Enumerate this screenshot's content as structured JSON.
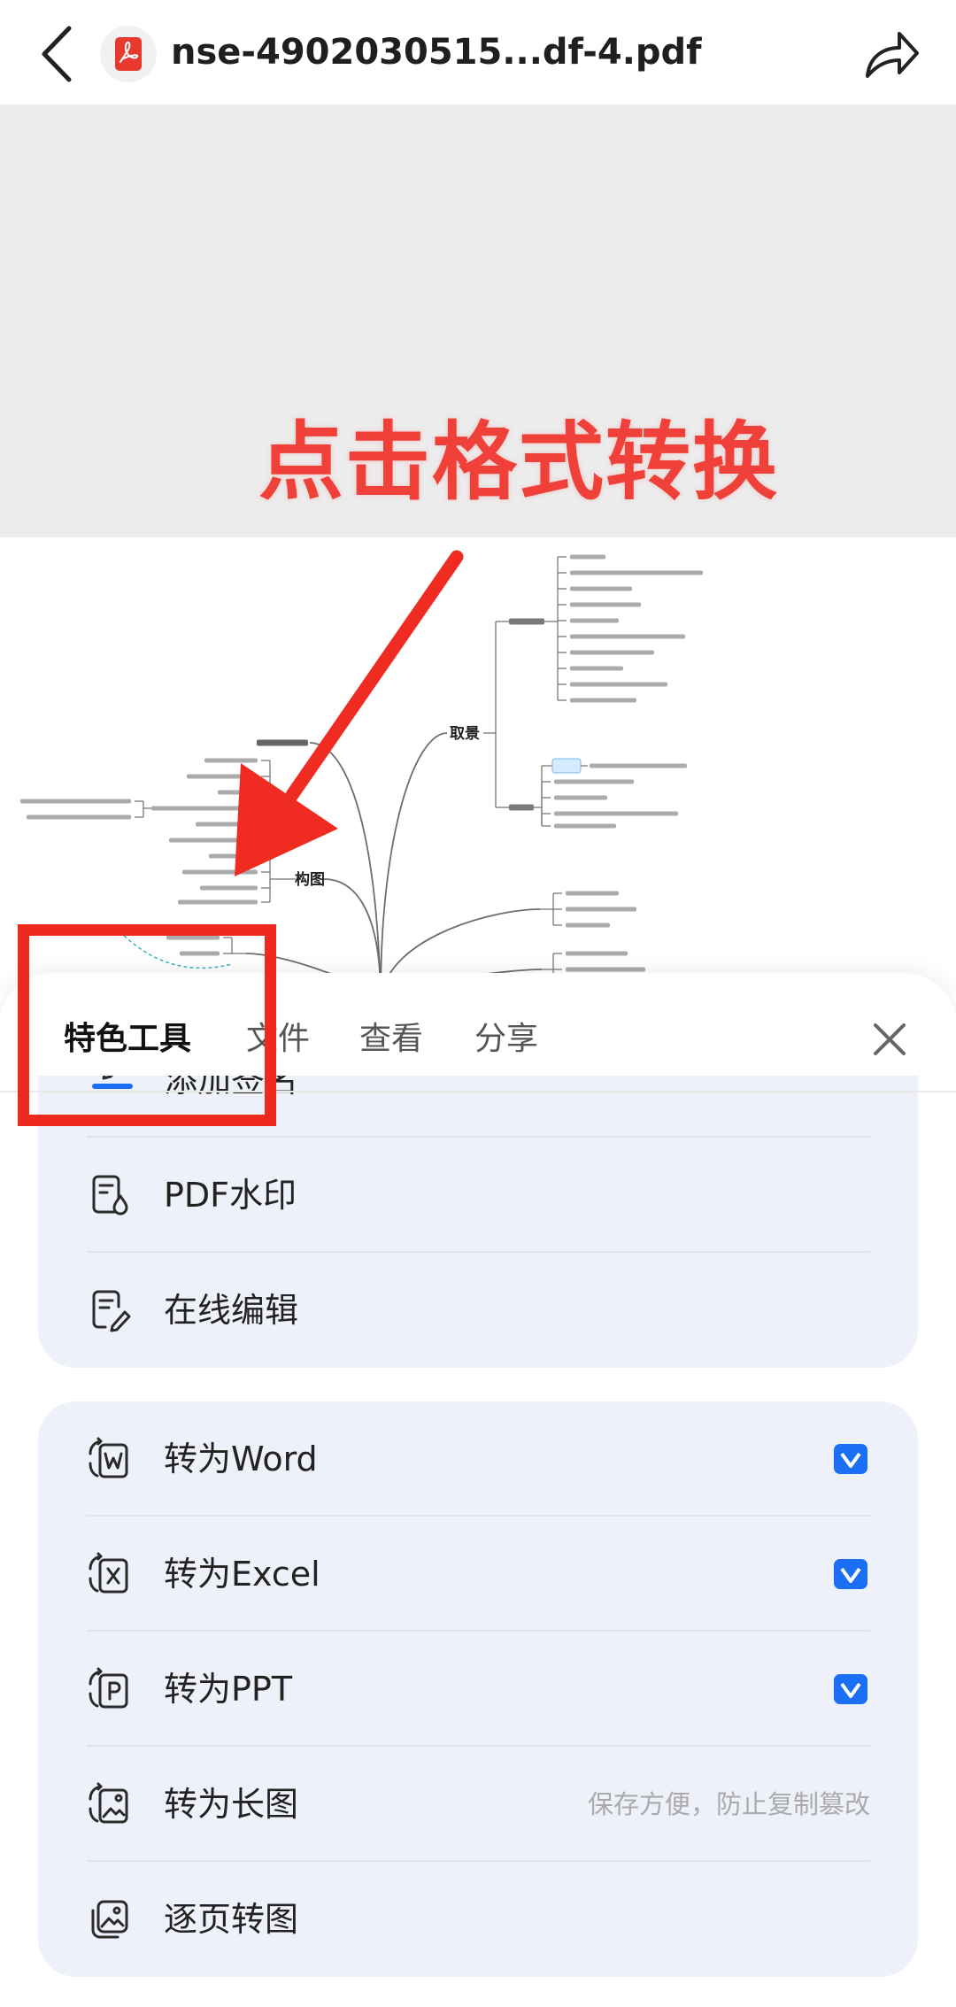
{
  "header": {
    "title": "nse-4902030515...df-4.pdf",
    "icons": {
      "back": "back-arrow-icon",
      "file": "pdf-file-icon",
      "share": "share-icon"
    }
  },
  "annotation": {
    "text": "点击格式转换",
    "color": "#f0403a"
  },
  "preview": {
    "nodes": {
      "branch_1": "取景",
      "branch_2": "构图"
    }
  },
  "sheet": {
    "tabs": [
      {
        "label": "特色工具",
        "active": true
      },
      {
        "label": "文件",
        "active": false
      },
      {
        "label": "查看",
        "active": false
      },
      {
        "label": "分享",
        "active": false
      }
    ],
    "close_icon": "close-icon",
    "groups": [
      {
        "items": [
          {
            "label": "添加签名",
            "icon": "signature-icon"
          },
          {
            "label": "PDF水印",
            "icon": "watermark-icon"
          },
          {
            "label": "在线编辑",
            "icon": "edit-document-icon"
          }
        ]
      },
      {
        "items": [
          {
            "label": "转为Word",
            "icon": "to-word-icon",
            "vip": true,
            "badge_icon": "vip-badge-icon"
          },
          {
            "label": "转为Excel",
            "icon": "to-excel-icon",
            "vip": true,
            "badge_icon": "vip-badge-icon"
          },
          {
            "label": "转为PPT",
            "icon": "to-ppt-icon",
            "vip": true,
            "badge_icon": "vip-badge-icon"
          },
          {
            "label": "转为长图",
            "icon": "to-long-image-icon",
            "hint": "保存方便，防止复制篡改"
          },
          {
            "label": "逐页转图",
            "icon": "page-to-image-icon"
          }
        ]
      }
    ]
  },
  "colors": {
    "highlight_red": "#ee2a1f",
    "accent_blue": "#1a6ff5",
    "card_background": "#eef1f9",
    "text": "#222222",
    "muted_text": "#aaaaaa"
  }
}
